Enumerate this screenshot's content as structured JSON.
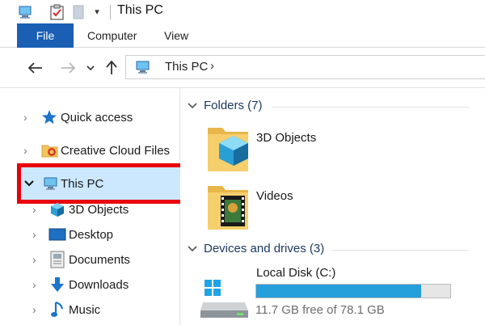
{
  "window": {
    "title": "This PC"
  },
  "ribbon": {
    "tabs": [
      "File",
      "Computer",
      "View"
    ]
  },
  "address": {
    "path": "This PC",
    "chevron": "›"
  },
  "nav_pane": {
    "items": [
      {
        "label": "Quick access",
        "icon": "star-icon"
      },
      {
        "label": "Creative Cloud Files",
        "icon": "creative-cloud-folder-icon"
      },
      {
        "label": "This PC",
        "icon": "computer-icon",
        "selected": true,
        "expanded": true
      },
      {
        "label": "3D Objects",
        "icon": "cube-icon"
      },
      {
        "label": "Desktop",
        "icon": "desktop-icon"
      },
      {
        "label": "Documents",
        "icon": "document-icon"
      },
      {
        "label": "Downloads",
        "icon": "download-arrow-icon"
      },
      {
        "label": "Music",
        "icon": "music-note-icon"
      }
    ]
  },
  "content": {
    "folders_header": "Folders (7)",
    "folders": [
      {
        "label": "3D Objects",
        "icon": "3d-objects-folder-icon"
      },
      {
        "label": "Videos",
        "icon": "videos-folder-icon"
      }
    ],
    "drives_header": "Devices and drives (3)",
    "drives": [
      {
        "label": "Local Disk (C:)",
        "free_text": "11.7 GB free of 78.1 GB",
        "used_fraction": 0.85,
        "icon": "windows-drive-icon"
      }
    ]
  },
  "colors": {
    "accent": "#1a5fb4",
    "selection": "#cce8ff",
    "highlight_border": "#e8000b",
    "progress": "#26a0da"
  }
}
